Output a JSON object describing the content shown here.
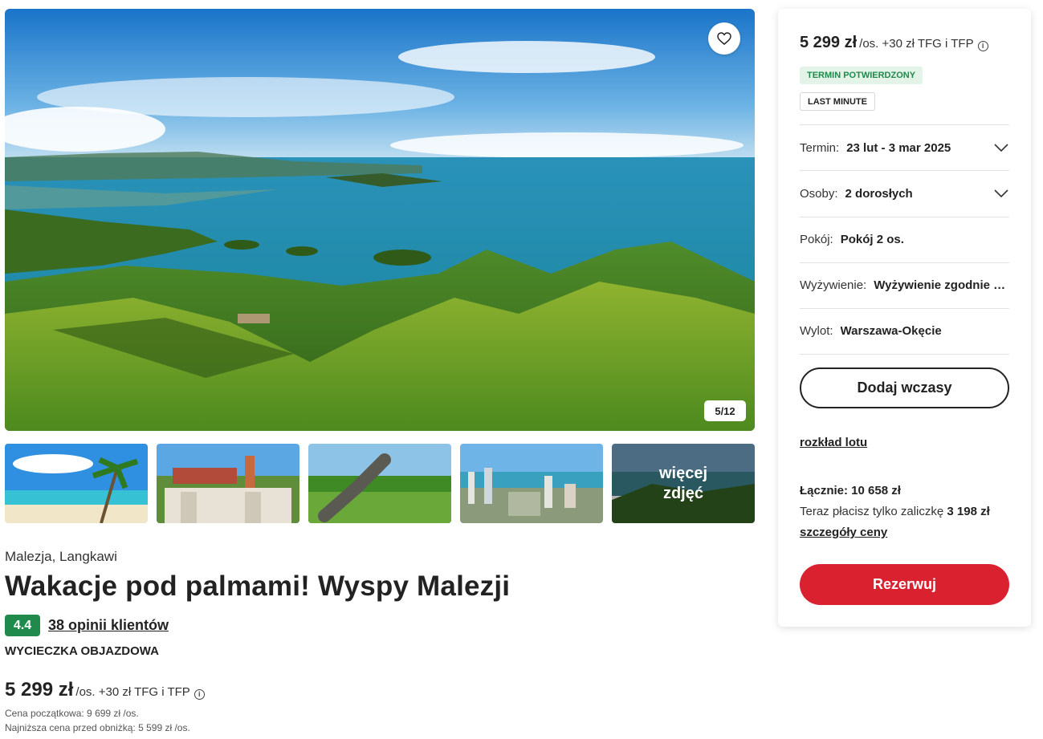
{
  "gallery": {
    "counter": "5/12",
    "more_photos_label": "więcej\nzdjęć"
  },
  "offer": {
    "location": "Malezja, Langkawi",
    "title": "Wakacje pod palmami! Wyspy Malezji",
    "rating": "4.4",
    "reviews_link": "38 opinii klientów",
    "trip_type": "WYCIECZKA OBJAZDOWA",
    "price": "5 299 zł",
    "price_suffix": "/os. +30 zł TFG i TFP",
    "initial_price_note": "Cena początkowa: 9 699 zł /os.",
    "lowest_price_note": "Najniższa cena przed obniżką: 5 599 zł /os."
  },
  "panel": {
    "price": "5 299 zł",
    "price_suffix": "/os. +30 zł TFG i TFP",
    "badge_confirmed": "TERMIN POTWIERDZONY",
    "badge_last_minute": "LAST MINUTE",
    "rows": [
      {
        "label": "Termin:",
        "value": "23 lut - 3 mar 2025",
        "has_dropdown": true
      },
      {
        "label": "Osoby:",
        "value": "2 dorosłych",
        "has_dropdown": true
      },
      {
        "label": "Pokój:",
        "value": "Pokój 2 os.",
        "has_dropdown": false
      },
      {
        "label": "Wyżywienie:",
        "value": "Wyżywienie zgodnie z programem",
        "has_dropdown": false
      },
      {
        "label": "Wylot:",
        "value": "Warszawa-Okęcie",
        "has_dropdown": false
      }
    ],
    "add_button": "Dodaj wczasy",
    "flight_schedule_link": "rozkład lotu",
    "total": "Łącznie: 10 658 zł",
    "deposit_prefix": "Teraz płacisz tylko zaliczkę",
    "deposit_amount": "3 198 zł",
    "price_details_link": "szczegóły ceny",
    "reserve_button": "Rezerwuj"
  },
  "colors": {
    "reserve_red": "#da2130",
    "rating_green": "#1f8a4c",
    "badge_green_bg": "#e3f3e8"
  }
}
